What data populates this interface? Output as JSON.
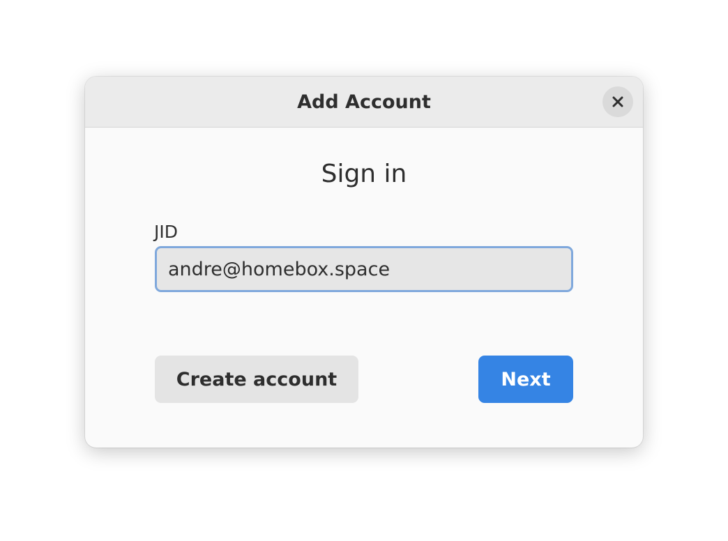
{
  "window": {
    "title": "Add Account",
    "close_icon": "close-icon"
  },
  "content": {
    "heading": "Sign in",
    "jid_label": "JID",
    "jid_value": "andre@homebox.space"
  },
  "buttons": {
    "create_account_label": "Create account",
    "next_label": "Next"
  },
  "colors": {
    "accent": "#3584e4",
    "focus_border": "#7fa8dc",
    "headerbar_bg": "#ebebeb",
    "dialog_bg": "#fafafa"
  }
}
